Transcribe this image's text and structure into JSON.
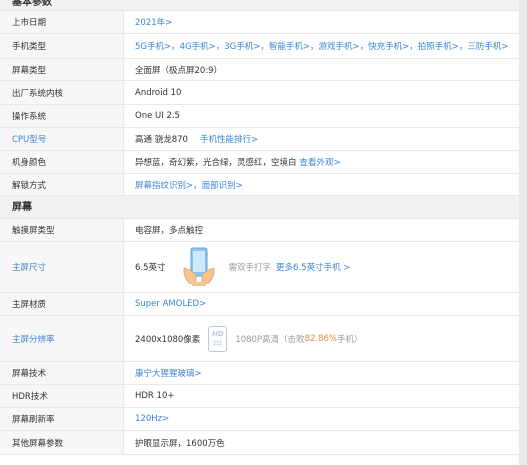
{
  "sections": {
    "basic": "基本参数",
    "screen": "屏幕"
  },
  "basic_rows": [
    {
      "key": "上市日期",
      "value": "2021年>"
    },
    {
      "key": "手机类型",
      "value": "5G手机>，4G手机>，3G手机>，智能手机>，游戏手机>，快充手机>，拍照手机>，三防手机>"
    },
    {
      "key": "屏幕类型",
      "value": "全面屏（极点屏20:9）"
    },
    {
      "key": "出厂系统内核",
      "value": "Android 10"
    },
    {
      "key": "操作系统",
      "value": "One UI 2.5"
    },
    {
      "key": "CPU型号",
      "value": "高通 骁龙870",
      "extra": "手机性能排行>"
    },
    {
      "key": "机身颜色",
      "value": "异想蓝，奇幻紫，光合绿，灵感红，空境白",
      "extra": "查看外观>"
    },
    {
      "key": "解锁方式",
      "value": "屏幕指纹识别>，面部识别>"
    }
  ],
  "screen_rows": {
    "touch": {
      "key": "触摸屏类型",
      "value": "电容屏，多点触控"
    },
    "size": {
      "key": "主屏尺寸",
      "value": "6.5英寸",
      "note": "需双手打字",
      "link": "更多6.5英寸手机 >"
    },
    "material": {
      "key": "主屏材质",
      "value": "Super AMOLED>"
    },
    "resolution": {
      "key": "主屏分辨率",
      "value": "2400x1080像素",
      "note_prefix": "1080P高清（击败",
      "percent": "82.86%",
      "note_suffix": "手机）",
      "icon_text": "HD"
    },
    "tech": {
      "key": "屏幕技术",
      "value": "康宁大猩猩玻璃>"
    },
    "hdr": {
      "key": "HDR技术",
      "value": "HDR 10+"
    },
    "refresh": {
      "key": "屏幕刷新率",
      "value": "120Hz>"
    },
    "other": {
      "key": "其他屏幕参数",
      "value": "护眼显示屏，1600万色"
    }
  },
  "colors": {
    "link": "#3b85d4",
    "highlight": "#f08a3c",
    "key_bg": "#f7f7f7",
    "section_bg": "#f2f2f2"
  },
  "icons": [
    "hand-holding-phone-icon",
    "hd-screen-icon"
  ]
}
